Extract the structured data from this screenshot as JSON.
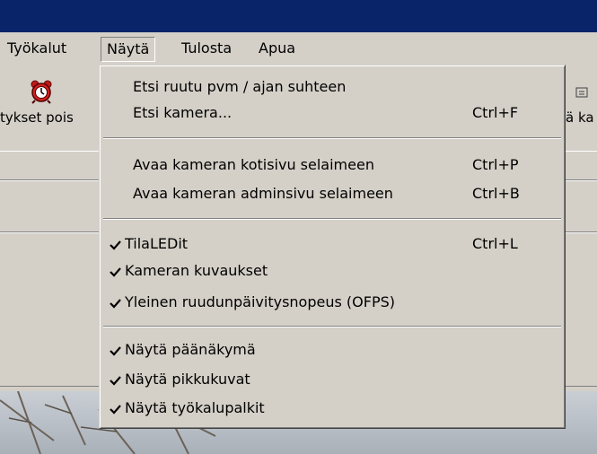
{
  "menubar": {
    "items": [
      {
        "label": "Työkalut"
      },
      {
        "label": "Näytä"
      },
      {
        "label": "Tulosta"
      },
      {
        "label": "Apua"
      }
    ]
  },
  "toolbar": {
    "left_label": "tykset pois",
    "right_label": "ä ka"
  },
  "dropdown": {
    "items": [
      {
        "label": "Etsi ruutu pvm / ajan suhteen",
        "shortcut": "",
        "checked": false
      },
      {
        "label": "Etsi kamera...",
        "shortcut": "Ctrl+F",
        "checked": false
      },
      {
        "label": "Avaa kameran kotisivu selaimeen",
        "shortcut": "Ctrl+P",
        "checked": false
      },
      {
        "label": "Avaa kameran adminsivu selaimeen",
        "shortcut": "Ctrl+B",
        "checked": false
      },
      {
        "label": "TilaLEDit",
        "shortcut": "Ctrl+L",
        "checked": true
      },
      {
        "label": "Kameran kuvaukset",
        "shortcut": "",
        "checked": true
      },
      {
        "label": "Yleinen ruudunpäivitysnopeus (OFPS)",
        "shortcut": "",
        "checked": true
      },
      {
        "label": "Näytä päänäkymä",
        "shortcut": "",
        "checked": true
      },
      {
        "label": "Näytä pikkukuvat",
        "shortcut": "",
        "checked": true
      },
      {
        "label": "Näytä työkalupalkit",
        "shortcut": "",
        "checked": true
      }
    ]
  },
  "colors": {
    "titlebar": "#0a246a",
    "face": "#d4d0c8"
  }
}
